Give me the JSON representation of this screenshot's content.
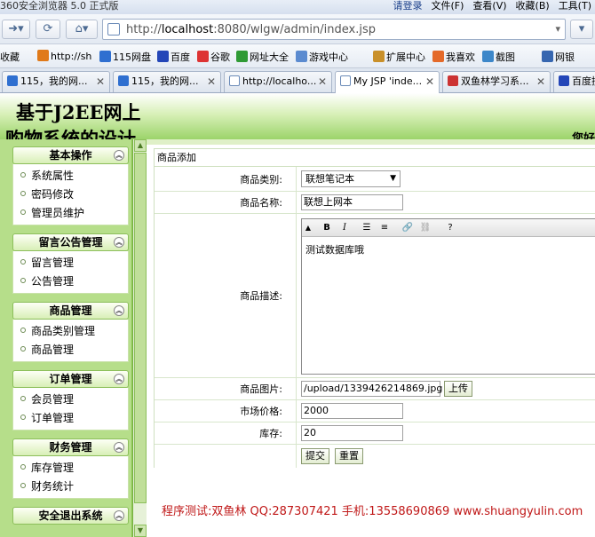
{
  "browser": {
    "app_title": "360安全浏览器 5.0 正式版",
    "login": "请登录",
    "menu": [
      "文件(F)",
      "查看(V)",
      "收藏(B)",
      "工具(T)"
    ],
    "url_prefix": "http://",
    "url_host": "localhost",
    "url_rest": ":8080/wlgw/admin/index.jsp",
    "favorites": [
      "收藏",
      "http://sh",
      "115网盘",
      "百度",
      "谷歌",
      "网址大全",
      "游戏中心",
      "扩展中心",
      "我喜欢",
      "截图",
      "网银"
    ],
    "tabs": [
      "115，我的网...",
      "115，我的网...",
      "http://localho...",
      "My JSP 'inde...",
      "双鱼林学习系...",
      "百度搜"
    ]
  },
  "header": {
    "title_line1": "基于J2EE网上",
    "title_line2": "购物系统的设计",
    "welcome": "您好"
  },
  "sidebar": {
    "groups": [
      {
        "title": "基本操作",
        "items": [
          "系统属性",
          "密码修改",
          "管理员维护"
        ]
      },
      {
        "title": "留言公告管理",
        "items": [
          "留言管理",
          "公告管理"
        ]
      },
      {
        "title": "商品管理",
        "items": [
          "商品类别管理",
          "商品管理"
        ]
      },
      {
        "title": "订单管理",
        "items": [
          "会员管理",
          "订单管理"
        ]
      },
      {
        "title": "财务管理",
        "items": [
          "库存管理",
          "财务统计"
        ]
      },
      {
        "title": "安全退出系统",
        "items": []
      }
    ]
  },
  "form": {
    "caption": "商品添加",
    "category_label": "商品类别:",
    "category_value": "联想笔记本",
    "name_label": "商品名称:",
    "name_value": "联想上网本",
    "desc_label": "商品描述:",
    "desc_value": "测试数据库哦",
    "image_label": "商品图片:",
    "image_value": "/upload/1339426214869.jpg",
    "upload_label": "上传",
    "price_label": "市场价格:",
    "price_value": "2000",
    "stock_label": "库存:",
    "stock_value": "20",
    "submit_label": "提交",
    "reset_label": "重置"
  },
  "footer": "程序测试:双鱼林 QQ:287307421 手机:13558690869 www.shuangyulin.com"
}
